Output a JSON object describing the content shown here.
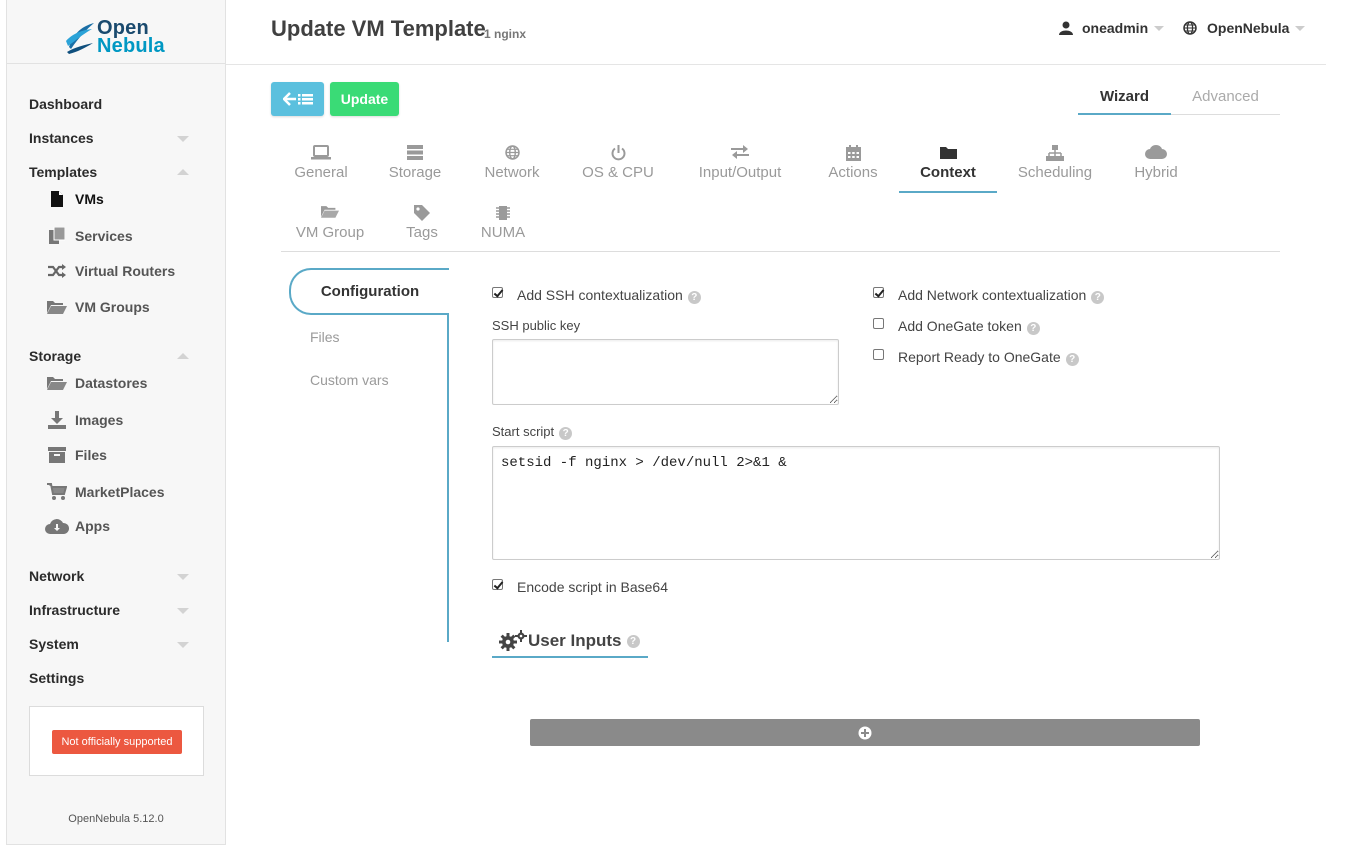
{
  "brand": {
    "word1": "Open",
    "word2": "Nebula"
  },
  "sidebar": {
    "items": [
      {
        "label": "Dashboard"
      },
      {
        "label": "Instances"
      },
      {
        "label": "Templates"
      },
      {
        "label": "Storage"
      },
      {
        "label": "Network"
      },
      {
        "label": "Infrastructure"
      },
      {
        "label": "System"
      },
      {
        "label": "Settings"
      }
    ],
    "templates_sub": [
      {
        "label": "VMs",
        "icon": "file-icon"
      },
      {
        "label": "Services",
        "icon": "files-icon"
      },
      {
        "label": "Virtual Routers",
        "icon": "shuffle-icon"
      },
      {
        "label": "VM Groups",
        "icon": "folder-open-icon"
      }
    ],
    "storage_sub": [
      {
        "label": "Datastores",
        "icon": "folder-open-icon"
      },
      {
        "label": "Images",
        "icon": "download-icon"
      },
      {
        "label": "Files",
        "icon": "archive-icon"
      },
      {
        "label": "MarketPlaces",
        "icon": "cart-icon"
      },
      {
        "label": "Apps",
        "icon": "cloud-download-icon"
      }
    ],
    "badge": "Not officially supported",
    "version": "OpenNebula 5.12.0"
  },
  "header": {
    "title": "Update VM Template",
    "subtitle": "1 nginx",
    "user": "oneadmin",
    "zone": "OpenNebula"
  },
  "toolbar": {
    "update_label": "Update"
  },
  "mode_tabs": {
    "wizard": "Wizard",
    "advanced": "Advanced"
  },
  "section_tabs": [
    {
      "label": "General",
      "icon": "laptop-icon"
    },
    {
      "label": "Storage",
      "icon": "database-icon"
    },
    {
      "label": "Network",
      "icon": "globe-icon"
    },
    {
      "label": "OS & CPU",
      "icon": "power-icon"
    },
    {
      "label": "Input/Output",
      "icon": "exchange-icon"
    },
    {
      "label": "Actions",
      "icon": "calendar-icon"
    },
    {
      "label": "Context",
      "icon": "folder-icon"
    },
    {
      "label": "Scheduling",
      "icon": "sitemap-icon"
    },
    {
      "label": "Hybrid",
      "icon": "cloud-icon"
    },
    {
      "label": "VM Group",
      "icon": "folder-open-icon"
    },
    {
      "label": "Tags",
      "icon": "tag-icon"
    },
    {
      "label": "NUMA",
      "icon": "microchip-icon"
    }
  ],
  "context_tabs": {
    "configuration": "Configuration",
    "files": "Files",
    "custom_vars": "Custom vars"
  },
  "form": {
    "add_ssh": {
      "label": "Add SSH contextualization",
      "checked": true
    },
    "ssh_key_label": "SSH public key",
    "ssh_key_value": "",
    "add_network": {
      "label": "Add Network contextualization",
      "checked": true
    },
    "add_onegate": {
      "label": "Add OneGate token",
      "checked": false
    },
    "report_ready": {
      "label": "Report Ready to OneGate",
      "checked": false
    },
    "start_script_label": "Start script",
    "start_script_value": "setsid -f nginx > /dev/null 2>&1 &",
    "encode_base64": {
      "label": "Encode script in Base64",
      "checked": true
    },
    "user_inputs_title": "User Inputs"
  },
  "help_glyph": "?"
}
